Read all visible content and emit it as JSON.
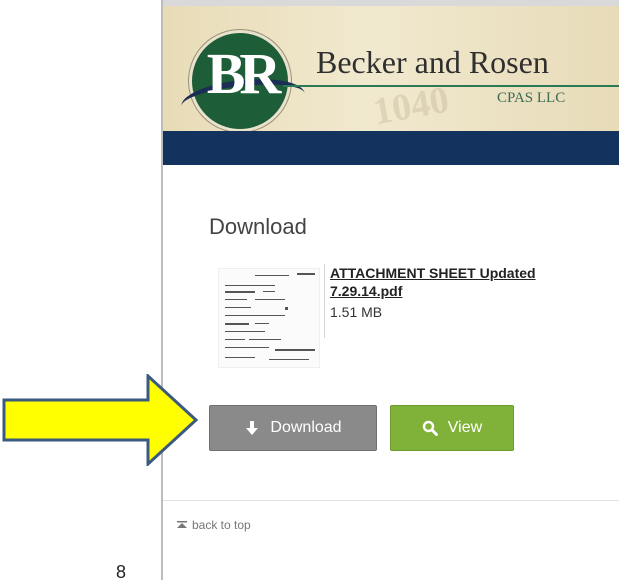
{
  "header": {
    "logo_letters": "BR",
    "firm_name": "Becker and Rosen",
    "firm_subtitle": "CPAS LLC",
    "watermark_text": "1040"
  },
  "download_section": {
    "title": "Download",
    "file": {
      "name": "ATTACHMENT SHEET Updated 7.29.14.pdf",
      "size": "1.51 MB"
    },
    "download_button_label": "Download",
    "view_button_label": "View"
  },
  "footer": {
    "back_to_top_label": "back to top"
  },
  "page_number": "8",
  "colors": {
    "nav_bar": "#14325e",
    "download_button": "#8a8a8a",
    "view_button": "#80b23a",
    "logo_green": "#1d5e38",
    "arrow_fill": "#ffff00",
    "arrow_stroke": "#3b5a80"
  },
  "icons": {
    "download": "arrow-down-icon",
    "view": "magnifier-icon",
    "back_to_top": "arrow-up-to-line-icon",
    "annotation": "right-arrow-icon"
  }
}
